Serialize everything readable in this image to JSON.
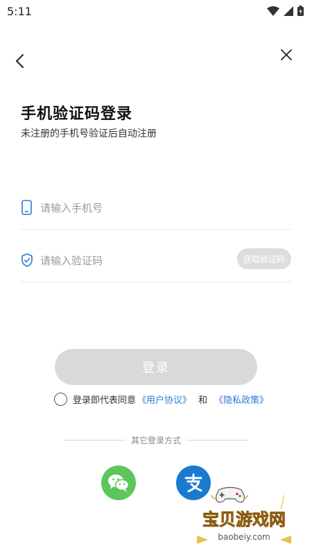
{
  "status_bar": {
    "time": "5:11"
  },
  "header": {
    "title": "手机验证码登录",
    "subtitle": "未注册的手机号验证后自动注册"
  },
  "form": {
    "phone_placeholder": "请输入手机号",
    "code_placeholder": "请输入验证码",
    "get_code_label": "获取验证码"
  },
  "login_button_label": "登录",
  "agreement": {
    "prefix": "登录即代表同意",
    "user_agreement": "《用户协议》",
    "and": "和",
    "privacy_policy": "《隐私政策》"
  },
  "other_login": {
    "label": "其它登录方式",
    "options": [
      "wechat-icon",
      "alipay-icon"
    ]
  },
  "watermark": {
    "title": "宝贝游戏网",
    "url": "baobeiy.com"
  },
  "colors": {
    "accent_link": "#2a79d8",
    "disabled_button": "#d9d9d9",
    "wechat": "#5ec55a",
    "alipay": "#1a7ad0"
  }
}
